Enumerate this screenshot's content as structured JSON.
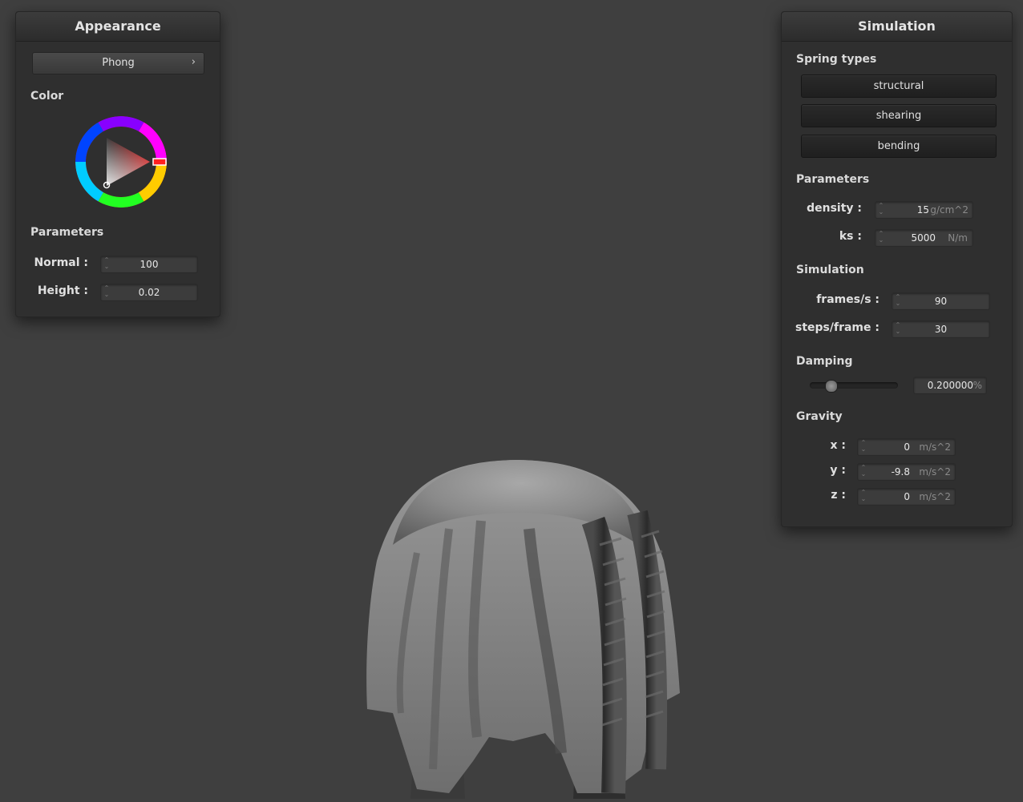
{
  "appearance": {
    "title": "Appearance",
    "shader": "Phong",
    "color_label": "Color",
    "color_hex": "#d42020",
    "params_label": "Parameters",
    "normal": {
      "label": "Normal :",
      "value": "100"
    },
    "height": {
      "label": "Height :",
      "value": "0.02"
    }
  },
  "simulation": {
    "title": "Simulation",
    "spring_types_label": "Spring types",
    "spring_types": [
      "structural",
      "shearing",
      "bending"
    ],
    "params_label": "Parameters",
    "density": {
      "label": "density :",
      "value": "15",
      "unit": "g/cm^2"
    },
    "ks": {
      "label": "ks :",
      "value": "5000",
      "unit": "N/m"
    },
    "sim_label": "Simulation",
    "fps": {
      "label": "frames/s :",
      "value": "90"
    },
    "steps": {
      "label": "steps/frame :",
      "value": "30"
    },
    "damping_label": "Damping",
    "damping": {
      "value": "0.200000",
      "unit": "%",
      "slider_fraction": 0.2
    },
    "gravity_label": "Gravity",
    "gx": {
      "label": "x :",
      "value": "0",
      "unit": "m/s^2"
    },
    "gy": {
      "label": "y :",
      "value": "-9.8",
      "unit": "m/s^2"
    },
    "gz": {
      "label": "z :",
      "value": "0",
      "unit": "m/s^2"
    }
  }
}
